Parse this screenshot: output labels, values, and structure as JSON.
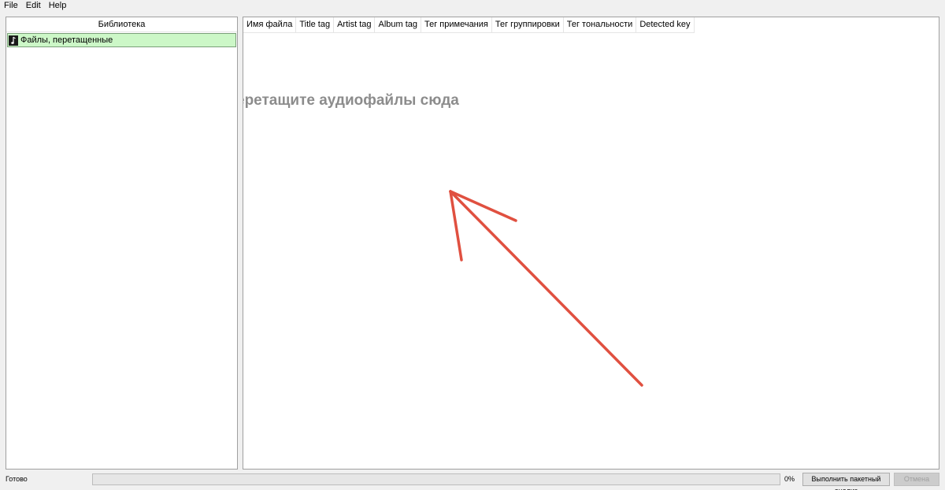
{
  "menu": {
    "items": [
      {
        "label": "File"
      },
      {
        "label": "Edit"
      },
      {
        "label": "Help"
      }
    ]
  },
  "library": {
    "header": "Библиотека",
    "items": [
      {
        "label": "Файлы, перетащенные",
        "icon": "music-file-icon",
        "selected": true,
        "highlight_color": "#ccf7c7"
      }
    ]
  },
  "files": {
    "columns": [
      "Имя файла",
      "Title tag",
      "Artist tag",
      "Album tag",
      "Тег примечания",
      "Тег группировки",
      "Тег тональности",
      "Detected key"
    ],
    "drop_hint": "еретащите аудиофайлы сюда"
  },
  "annotation": {
    "color": "#e05040",
    "shape": "arrow-pointing-up-left"
  },
  "status": {
    "text": "Готово",
    "progress_percent": 0,
    "progress_label": "0%",
    "batch_button": "Выполнить пакетный анализ",
    "cancel_button": "Отмена"
  }
}
